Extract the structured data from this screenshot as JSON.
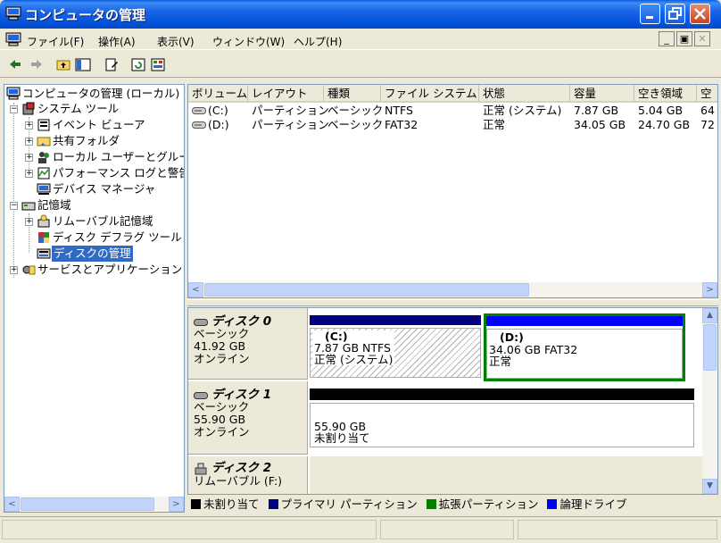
{
  "window": {
    "title": "コンピュータの管理"
  },
  "menubar": {
    "items": [
      "ファイル(F)",
      "操作(A)",
      "表示(V)",
      "ウィンドウ(W)",
      "ヘルプ(H)"
    ]
  },
  "tree": {
    "items": [
      {
        "label": "コンピュータの管理 (ローカル)"
      },
      {
        "label": "システム ツール"
      },
      {
        "label": "イベント ビューア"
      },
      {
        "label": "共有フォルダ"
      },
      {
        "label": "ローカル ユーザーとグルー"
      },
      {
        "label": "パフォーマンス ログと警告"
      },
      {
        "label": "デバイス マネージャ"
      },
      {
        "label": "記憶域"
      },
      {
        "label": "リムーバブル記憶域"
      },
      {
        "label": "ディスク デフラグ ツール"
      },
      {
        "label": "ディスクの管理"
      },
      {
        "label": "サービスとアプリケーション"
      }
    ]
  },
  "list": {
    "columns": [
      "ボリューム",
      "レイアウト",
      "種類",
      "ファイル システム",
      "状態",
      "容量",
      "空き領域",
      "空"
    ],
    "rows": [
      [
        "(C:)",
        "パーティション",
        "ベーシック",
        "NTFS",
        "正常 (システム)",
        "7.87 GB",
        "5.04 GB",
        "64"
      ],
      [
        "(D:)",
        "パーティション",
        "ベーシック",
        "FAT32",
        "正常",
        "34.05 GB",
        "24.70 GB",
        "72"
      ]
    ]
  },
  "disks": [
    {
      "name": "ディスク 0",
      "type": "ベーシック",
      "size": "41.92 GB",
      "status": "オンライン",
      "volumes": [
        {
          "label": "(C:)",
          "detail": "7.87 GB NTFS",
          "status": "正常 (システム)"
        },
        {
          "label": "(D:)",
          "detail": "34.06 GB FAT32",
          "status": "正常"
        }
      ]
    },
    {
      "name": "ディスク 1",
      "type": "ベーシック",
      "size": "55.90 GB",
      "status": "オンライン",
      "volumes": [
        {
          "detail": "55.90 GB",
          "status": "未割り当て"
        }
      ]
    },
    {
      "name": "ディスク 2",
      "type": "リムーバブル (F:)"
    }
  ],
  "legend": {
    "items": [
      {
        "label": "未割り当て",
        "color": "#000000"
      },
      {
        "label": "プライマリ パーティション",
        "color": "#000080"
      },
      {
        "label": "拡張パーティション",
        "color": "#008000"
      },
      {
        "label": "論理ドライブ",
        "color": "#0000ff"
      }
    ]
  },
  "colors": {
    "titlebar": "#0a5fe0",
    "selection": "#316ac5",
    "primary_partition": "#000080",
    "logical_drive": "#0000ff",
    "extended_partition": "#008000",
    "unallocated": "#000000"
  }
}
